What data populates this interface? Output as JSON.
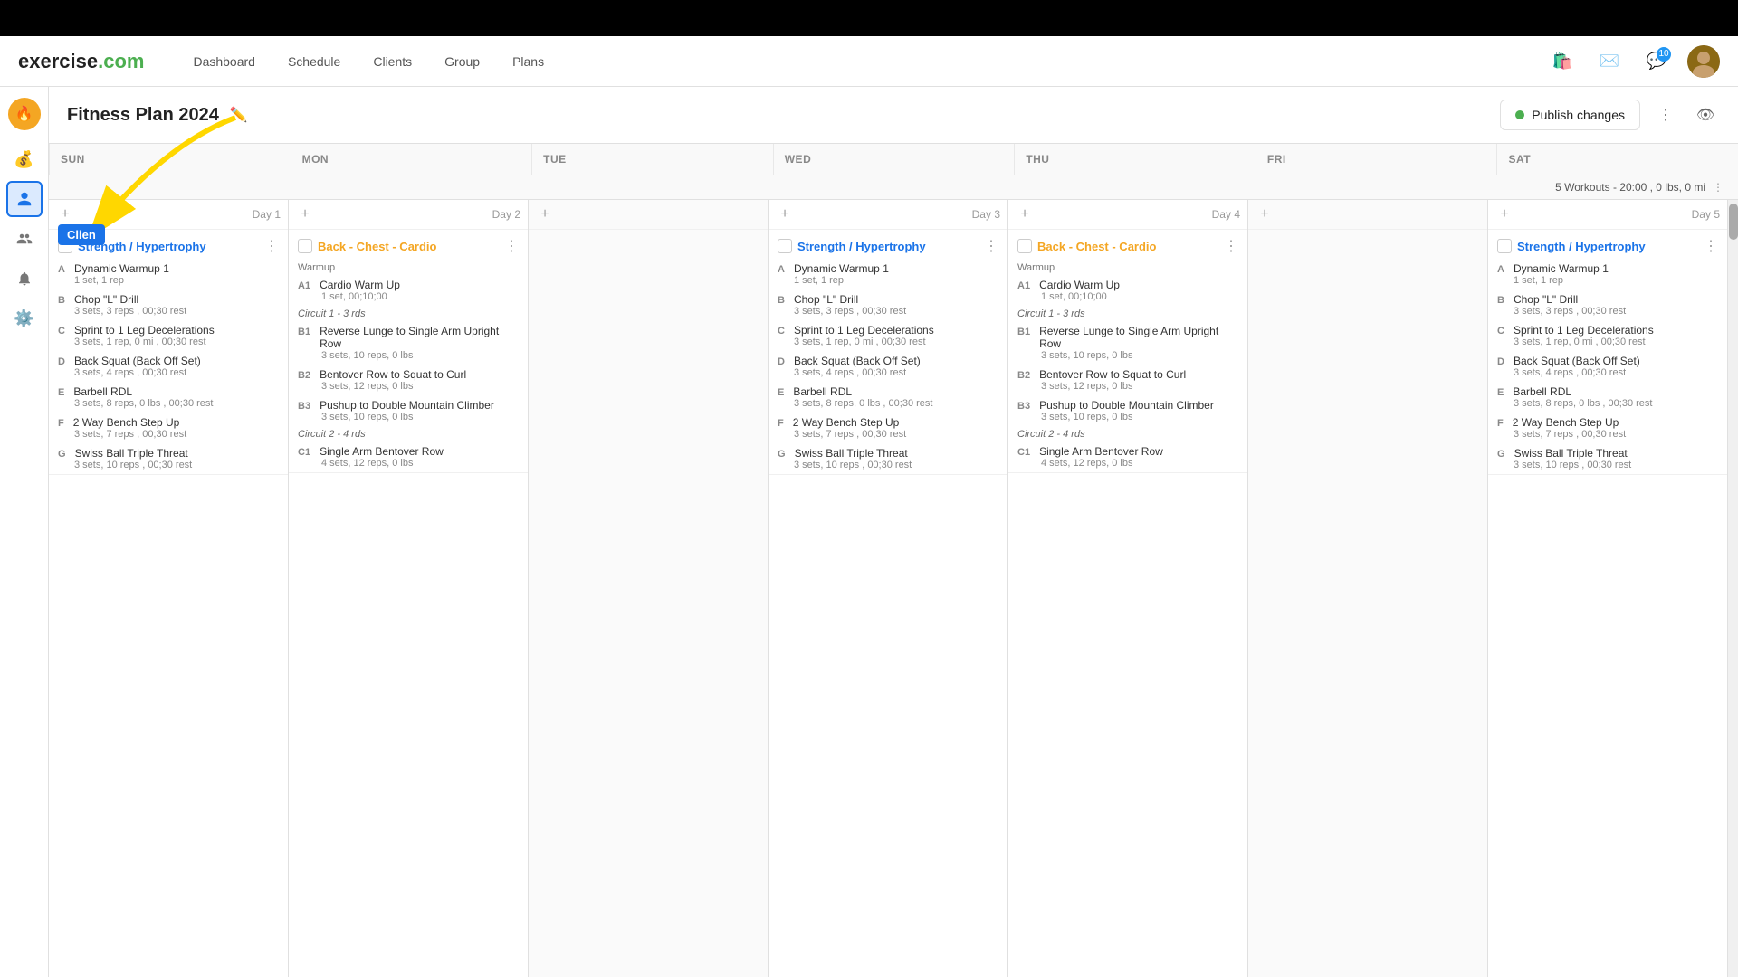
{
  "app": {
    "name": "exercise",
    "name_colored": ".com"
  },
  "nav": {
    "links": [
      "Dashboard",
      "Schedule",
      "Clients",
      "Group",
      "Plans"
    ],
    "notification_count": "10"
  },
  "plan": {
    "title": "Fitness Plan 2024",
    "publish_btn": "Publish changes",
    "workouts_summary": "5 Workouts - 20:00 , 0 lbs, 0 mi"
  },
  "day_headers": [
    "SUN",
    "MON",
    "TUE",
    "WED",
    "THU",
    "FRI",
    "SAT"
  ],
  "days": [
    {
      "id": "sun",
      "label": "Day 1",
      "workout": {
        "title": "Strength / Hypertrophy",
        "color": "blue",
        "sections": [
          {
            "type": "label",
            "text": ""
          }
        ],
        "exercises": [
          {
            "letter": "A",
            "name": "Dynamic Warmup 1",
            "detail": "1 set, 1 rep"
          },
          {
            "letter": "B",
            "name": "Chop \"L\" Drill",
            "detail": "3 sets, 3 reps , 00;30 rest"
          },
          {
            "letter": "C",
            "name": "Sprint to 1 Leg Decelerations",
            "detail": "3 sets, 1 rep, 0 mi , 00;30 rest"
          },
          {
            "letter": "D",
            "name": "Back Squat (Back Off Set)",
            "detail": "3 sets, 4 reps , 00;30 rest"
          },
          {
            "letter": "E",
            "name": "Barbell RDL",
            "detail": "3 sets, 8 reps, 0 lbs , 00;30 rest"
          },
          {
            "letter": "F",
            "name": "2 Way Bench Step Up",
            "detail": "3 sets, 7 reps , 00;30 rest"
          },
          {
            "letter": "G",
            "name": "Swiss Ball Triple Threat",
            "detail": "3 sets, 10 reps , 00;30 rest"
          }
        ]
      }
    },
    {
      "id": "mon",
      "label": "Day 2",
      "workout": {
        "title": "Back - Chest - Cardio",
        "color": "orange",
        "sections": [
          {
            "type": "label",
            "text": "Warmup"
          },
          {
            "exercises_before_circuit": [
              {
                "letter": "A1",
                "name": "Cardio Warm Up",
                "detail": "1 set, 00;10;00"
              }
            ]
          },
          {
            "type": "circuit",
            "text": "Circuit 1 - 3 rds"
          },
          {
            "circuit_exercises": [
              {
                "letter": "B1",
                "name": "Reverse Lunge to Single Arm Upright Row",
                "detail": "3 sets, 10 reps, 0 lbs"
              },
              {
                "letter": "B2",
                "name": "Bentover Row to Squat to Curl",
                "detail": "3 sets, 12 reps, 0 lbs"
              },
              {
                "letter": "B3",
                "name": "Pushup to Double Mountain Climber",
                "detail": "3 sets, 10 reps, 0 lbs"
              }
            ]
          },
          {
            "type": "circuit",
            "text": "Circuit 2 - 4 rds"
          },
          {
            "circuit_exercises2": [
              {
                "letter": "C1",
                "name": "Single Arm Bentover Row",
                "detail": "4 sets, 12 reps, 0 lbs"
              }
            ]
          }
        ]
      }
    },
    {
      "id": "tue",
      "label": "",
      "empty": true
    },
    {
      "id": "wed",
      "label": "Day 3",
      "workout": {
        "title": "Strength / Hypertrophy",
        "color": "blue",
        "exercises": [
          {
            "letter": "A",
            "name": "Dynamic Warmup 1",
            "detail": "1 set, 1 rep"
          },
          {
            "letter": "B",
            "name": "Chop \"L\" Drill",
            "detail": "3 sets, 3 reps , 00;30 rest"
          },
          {
            "letter": "C",
            "name": "Sprint to 1 Leg Decelerations",
            "detail": "3 sets, 1 rep, 0 mi , 00;30 rest"
          },
          {
            "letter": "D",
            "name": "Back Squat (Back Off Set)",
            "detail": "3 sets, 4 reps , 00;30 rest"
          },
          {
            "letter": "E",
            "name": "Barbell RDL",
            "detail": "3 sets, 8 reps, 0 lbs , 00;30 rest"
          },
          {
            "letter": "F",
            "name": "2 Way Bench Step Up",
            "detail": "3 sets, 7 reps , 00;30 rest"
          },
          {
            "letter": "G",
            "name": "Swiss Ball Triple Threat",
            "detail": "3 sets, 10 reps , 00;30 rest"
          }
        ]
      }
    },
    {
      "id": "thu",
      "label": "Day 4",
      "workout": {
        "title": "Back - Chest - Cardio",
        "color": "orange",
        "mon_copy": true
      }
    },
    {
      "id": "fri",
      "label": "",
      "empty": true
    },
    {
      "id": "sat",
      "label": "Day 5",
      "workout": {
        "title": "Strength / Hypertrophy",
        "color": "blue",
        "exercises": [
          {
            "letter": "A",
            "name": "Dynamic Warmup 1",
            "detail": "1 set, 1 rep"
          },
          {
            "letter": "B",
            "name": "Chop \"L\" Drill",
            "detail": "3 sets, 3 reps , 00;30 rest"
          },
          {
            "letter": "C",
            "name": "Sprint to 1 Leg Decelerations",
            "detail": "3 sets, 1 rep, 0 mi , 00;30 rest"
          },
          {
            "letter": "D",
            "name": "Back Squat (Back Off Set)",
            "detail": "3 sets, 4 reps , 00;30 rest"
          },
          {
            "letter": "E",
            "name": "Barbell RDL",
            "detail": "3 sets, 8 reps, 0 lbs , 00;30 rest"
          },
          {
            "letter": "F",
            "name": "2 Way Bench Step Up",
            "detail": "3 sets, 7 reps , 00;30 rest"
          },
          {
            "letter": "G",
            "name": "Swiss Ball Triple Threat",
            "detail": "3 sets, 10 reps , 00;30 rest"
          }
        ]
      }
    }
  ],
  "sidebar": {
    "items": [
      {
        "icon": "🔔",
        "label": "notifications"
      },
      {
        "icon": "💰",
        "label": "billing"
      },
      {
        "icon": "👤",
        "label": "clients",
        "active": true
      },
      {
        "icon": "👥",
        "label": "groups"
      },
      {
        "icon": "🔔",
        "label": "alerts"
      },
      {
        "icon": "⚙️",
        "label": "settings"
      }
    ]
  },
  "annotation": {
    "client_label": "Clien"
  },
  "thu_workout": {
    "warmup_label": "Warmup",
    "exercises_before": [
      {
        "letter": "A1",
        "name": "Cardio Warm Up",
        "detail": "1 set, 00;10;00"
      }
    ],
    "circuit1": "Circuit 1 - 3 rds",
    "circuit1_exercises": [
      {
        "letter": "B1",
        "name": "Reverse Lunge to Single Arm Upright Row",
        "detail": "3 sets, 10 reps, 0 lbs"
      },
      {
        "letter": "B2",
        "name": "Bentover Row to Squat to Curl",
        "detail": "3 sets, 12 reps, 0 lbs"
      },
      {
        "letter": "B3",
        "name": "Pushup to Double Mountain Climber",
        "detail": "3 sets, 10 reps, 0 lbs"
      }
    ],
    "circuit2": "Circuit 2 - 4 rds",
    "circuit2_exercises": [
      {
        "letter": "C1",
        "name": "Single Arm Bentover Row",
        "detail": "4 sets, 12 reps, 0 lbs"
      }
    ]
  }
}
